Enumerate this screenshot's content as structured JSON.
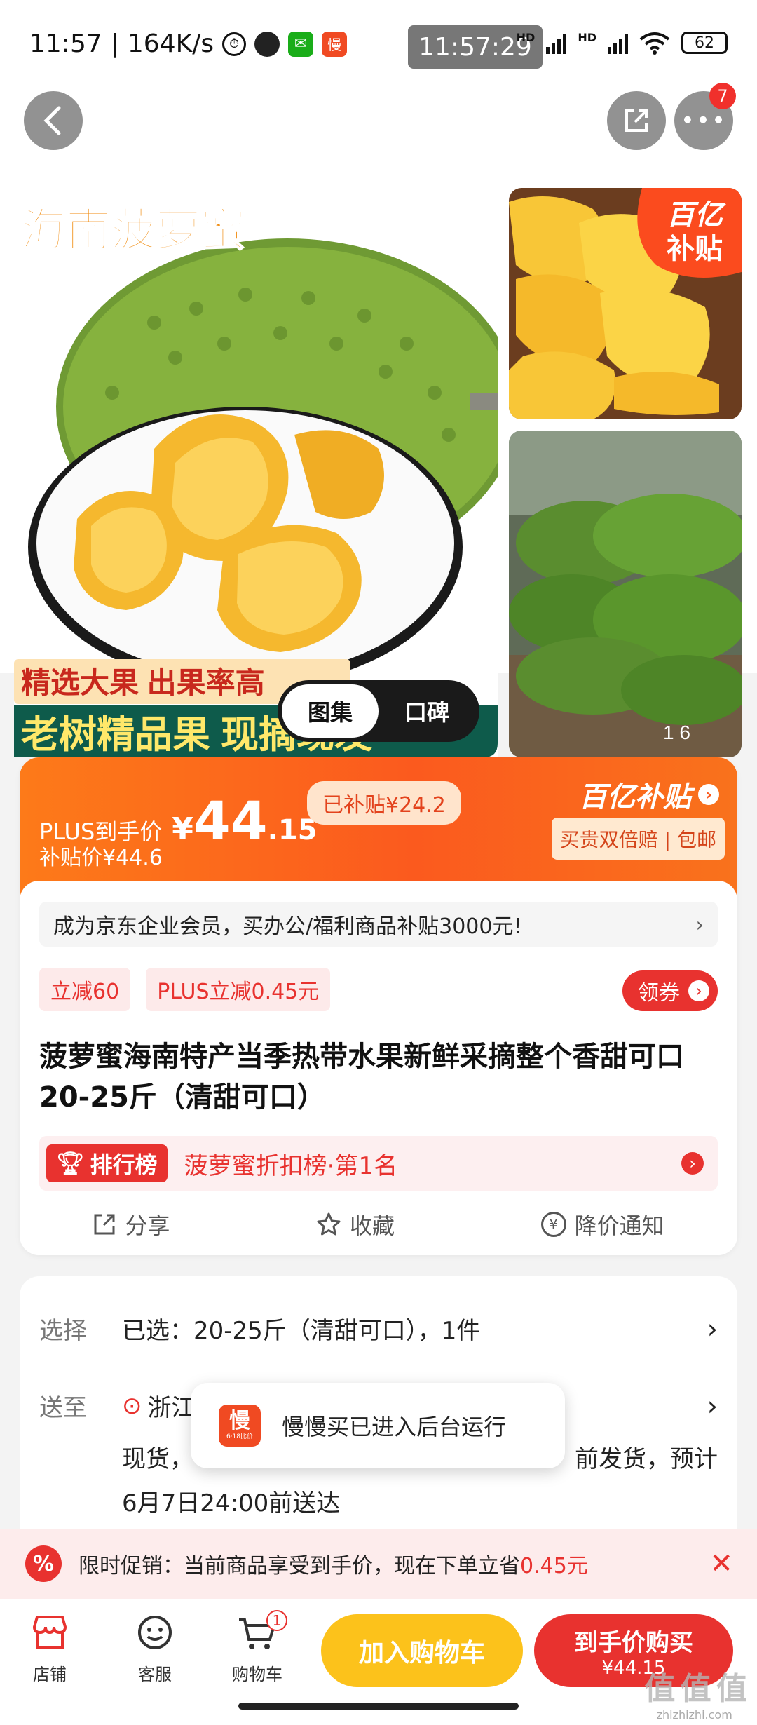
{
  "status": {
    "time": "11:57",
    "speed": "164K/s",
    "app_badge": "慢",
    "center_time": "11:57:29",
    "net1": "HD",
    "net2": "HD",
    "battery": "62"
  },
  "nav": {
    "more_count": "7"
  },
  "gallery": {
    "main_title": "海南菠萝蜜",
    "tagline1": "精选大果  出果率高",
    "tagline2": "老树精品果  现摘现发",
    "subsidy_badge_line1": "百亿",
    "subsidy_badge_line2": "补贴",
    "thumb_counter": "1   6"
  },
  "tabs": {
    "gallery": "图集",
    "reviews": "口碑"
  },
  "price": {
    "plus_label": "PLUS到手价",
    "currency": "¥",
    "amount_int": "44",
    "amount_dec": ".15",
    "subsidized_tag": "已补贴¥24.2",
    "subsidy_price": "补贴价¥44.6",
    "brand": "百亿补贴",
    "guarantee": "买贵双倍赔 | 包邮"
  },
  "enterprise_banner": "成为京东企业会员，买办公/福利商品补贴3000元!",
  "coupons": {
    "tag1": "立减60",
    "tag2": "PLUS立减0.45元",
    "get_coupon": "领券"
  },
  "product_title": "菠萝蜜海南特产当季热带水果新鲜采摘整个香甜可口 20-25斤（清甜可口）",
  "ranking": {
    "badge": "排行榜",
    "text": "菠萝蜜折扣榜·第1名"
  },
  "actions": {
    "share": "分享",
    "favorite": "收藏",
    "price_alert": "降价通知"
  },
  "select": {
    "label": "选择",
    "value": "已选：20-25斤（清甜可口），1件"
  },
  "delivery": {
    "label": "送至",
    "location": "浙江",
    "line2_left": "现货，",
    "line2_right": "前发货，预计",
    "line3": "6月7日24:00前送达"
  },
  "toast": {
    "app_name_icon": "慢",
    "app_sub": "6·18比价",
    "message": "慢慢买已进入后台运行"
  },
  "promo": {
    "text_prefix": "限时促销：当前商品享受到手价，现在下单立省",
    "amount": "0.45元"
  },
  "bottom": {
    "store": "店铺",
    "service": "客服",
    "cart": "购物车",
    "cart_count": "1",
    "add_cart": "加入购物车",
    "buy_line1": "到手价购买",
    "buy_line2": "¥44.15"
  },
  "watermark": "值 值 值",
  "watermark_sub": "zhizhizhi.com",
  "colors": {
    "accent": "#f23030",
    "orange": "#fb6a1c",
    "yellow": "#fcc419"
  }
}
